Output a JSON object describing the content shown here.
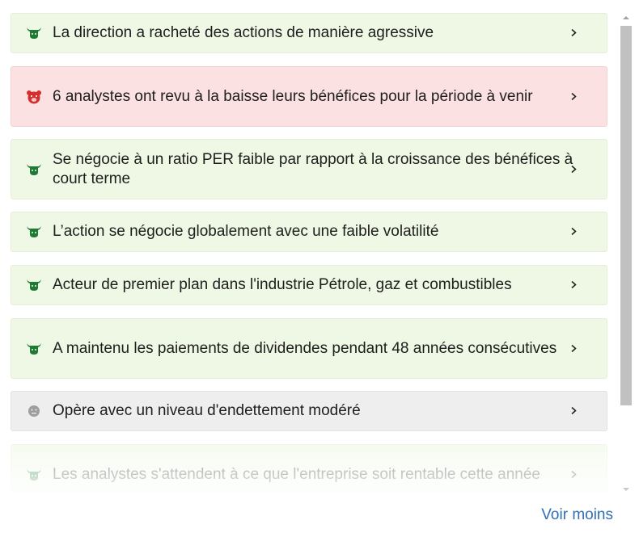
{
  "items": [
    {
      "sentiment": "positive",
      "icon": "bull-icon",
      "text": "La direction a racheté des actions de manière agressive"
    },
    {
      "sentiment": "negative",
      "icon": "bear-icon",
      "text": "6 analystes ont revu à la baisse leurs bénéfices pour la période à venir"
    },
    {
      "sentiment": "positive",
      "icon": "bull-icon",
      "text": "Se négocie à un ratio PER faible par rapport à la croissance des bénéfices à court terme"
    },
    {
      "sentiment": "positive",
      "icon": "bull-icon",
      "text": "L’action se négocie globalement avec une faible volatilité"
    },
    {
      "sentiment": "positive",
      "icon": "bull-icon",
      "text": "Acteur de premier plan dans l'industrie Pétrole, gaz et combustibles"
    },
    {
      "sentiment": "positive",
      "icon": "bull-icon",
      "text": "A maintenu les paiements de dividendes pendant 48 années consécutives"
    },
    {
      "sentiment": "neutral",
      "icon": "neutral-face-icon",
      "text": "Opère avec un niveau d'endettement modéré"
    },
    {
      "sentiment": "positive",
      "icon": "bull-icon",
      "text": "Les analystes s'attendent à ce que l'entreprise soit rentable cette année"
    }
  ],
  "toggle_label": "Voir moins",
  "colors": {
    "positive_bg": "#eef8e5",
    "negative_bg": "#fbe1e1",
    "neutral_bg": "#eeeeee",
    "bull": "#1e7a34",
    "bear": "#d32f2f",
    "neutral_icon": "#9e9e9e",
    "link": "#2f6fb6"
  }
}
